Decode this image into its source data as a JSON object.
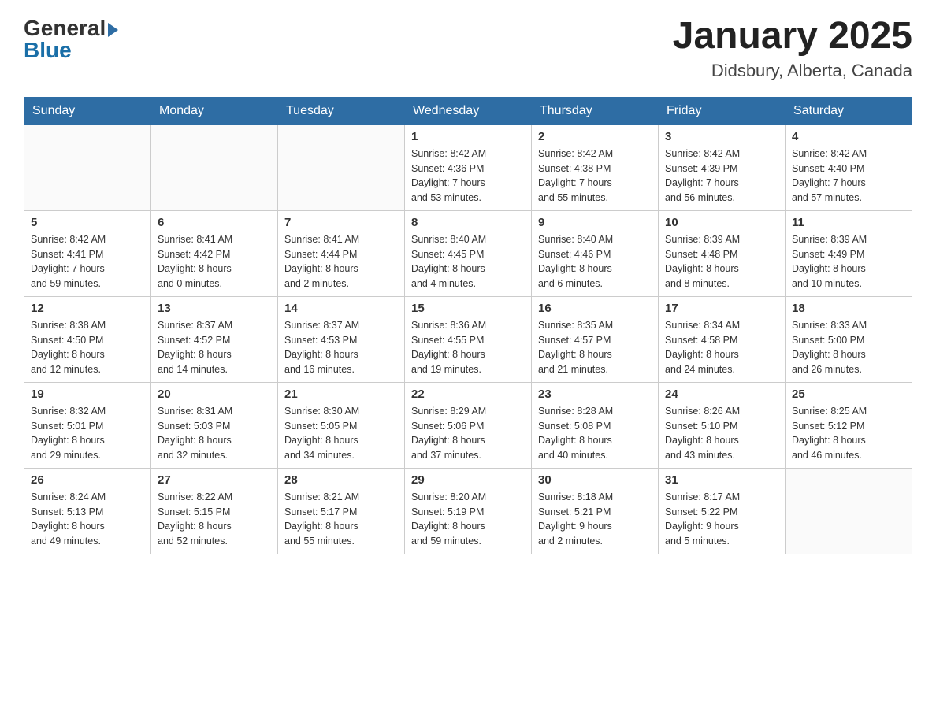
{
  "header": {
    "logo_general": "General",
    "logo_blue": "Blue",
    "month_title": "January 2025",
    "location": "Didsbury, Alberta, Canada"
  },
  "days_of_week": [
    "Sunday",
    "Monday",
    "Tuesday",
    "Wednesday",
    "Thursday",
    "Friday",
    "Saturday"
  ],
  "weeks": [
    [
      {
        "day": "",
        "info": ""
      },
      {
        "day": "",
        "info": ""
      },
      {
        "day": "",
        "info": ""
      },
      {
        "day": "1",
        "info": "Sunrise: 8:42 AM\nSunset: 4:36 PM\nDaylight: 7 hours\nand 53 minutes."
      },
      {
        "day": "2",
        "info": "Sunrise: 8:42 AM\nSunset: 4:38 PM\nDaylight: 7 hours\nand 55 minutes."
      },
      {
        "day": "3",
        "info": "Sunrise: 8:42 AM\nSunset: 4:39 PM\nDaylight: 7 hours\nand 56 minutes."
      },
      {
        "day": "4",
        "info": "Sunrise: 8:42 AM\nSunset: 4:40 PM\nDaylight: 7 hours\nand 57 minutes."
      }
    ],
    [
      {
        "day": "5",
        "info": "Sunrise: 8:42 AM\nSunset: 4:41 PM\nDaylight: 7 hours\nand 59 minutes."
      },
      {
        "day": "6",
        "info": "Sunrise: 8:41 AM\nSunset: 4:42 PM\nDaylight: 8 hours\nand 0 minutes."
      },
      {
        "day": "7",
        "info": "Sunrise: 8:41 AM\nSunset: 4:44 PM\nDaylight: 8 hours\nand 2 minutes."
      },
      {
        "day": "8",
        "info": "Sunrise: 8:40 AM\nSunset: 4:45 PM\nDaylight: 8 hours\nand 4 minutes."
      },
      {
        "day": "9",
        "info": "Sunrise: 8:40 AM\nSunset: 4:46 PM\nDaylight: 8 hours\nand 6 minutes."
      },
      {
        "day": "10",
        "info": "Sunrise: 8:39 AM\nSunset: 4:48 PM\nDaylight: 8 hours\nand 8 minutes."
      },
      {
        "day": "11",
        "info": "Sunrise: 8:39 AM\nSunset: 4:49 PM\nDaylight: 8 hours\nand 10 minutes."
      }
    ],
    [
      {
        "day": "12",
        "info": "Sunrise: 8:38 AM\nSunset: 4:50 PM\nDaylight: 8 hours\nand 12 minutes."
      },
      {
        "day": "13",
        "info": "Sunrise: 8:37 AM\nSunset: 4:52 PM\nDaylight: 8 hours\nand 14 minutes."
      },
      {
        "day": "14",
        "info": "Sunrise: 8:37 AM\nSunset: 4:53 PM\nDaylight: 8 hours\nand 16 minutes."
      },
      {
        "day": "15",
        "info": "Sunrise: 8:36 AM\nSunset: 4:55 PM\nDaylight: 8 hours\nand 19 minutes."
      },
      {
        "day": "16",
        "info": "Sunrise: 8:35 AM\nSunset: 4:57 PM\nDaylight: 8 hours\nand 21 minutes."
      },
      {
        "day": "17",
        "info": "Sunrise: 8:34 AM\nSunset: 4:58 PM\nDaylight: 8 hours\nand 24 minutes."
      },
      {
        "day": "18",
        "info": "Sunrise: 8:33 AM\nSunset: 5:00 PM\nDaylight: 8 hours\nand 26 minutes."
      }
    ],
    [
      {
        "day": "19",
        "info": "Sunrise: 8:32 AM\nSunset: 5:01 PM\nDaylight: 8 hours\nand 29 minutes."
      },
      {
        "day": "20",
        "info": "Sunrise: 8:31 AM\nSunset: 5:03 PM\nDaylight: 8 hours\nand 32 minutes."
      },
      {
        "day": "21",
        "info": "Sunrise: 8:30 AM\nSunset: 5:05 PM\nDaylight: 8 hours\nand 34 minutes."
      },
      {
        "day": "22",
        "info": "Sunrise: 8:29 AM\nSunset: 5:06 PM\nDaylight: 8 hours\nand 37 minutes."
      },
      {
        "day": "23",
        "info": "Sunrise: 8:28 AM\nSunset: 5:08 PM\nDaylight: 8 hours\nand 40 minutes."
      },
      {
        "day": "24",
        "info": "Sunrise: 8:26 AM\nSunset: 5:10 PM\nDaylight: 8 hours\nand 43 minutes."
      },
      {
        "day": "25",
        "info": "Sunrise: 8:25 AM\nSunset: 5:12 PM\nDaylight: 8 hours\nand 46 minutes."
      }
    ],
    [
      {
        "day": "26",
        "info": "Sunrise: 8:24 AM\nSunset: 5:13 PM\nDaylight: 8 hours\nand 49 minutes."
      },
      {
        "day": "27",
        "info": "Sunrise: 8:22 AM\nSunset: 5:15 PM\nDaylight: 8 hours\nand 52 minutes."
      },
      {
        "day": "28",
        "info": "Sunrise: 8:21 AM\nSunset: 5:17 PM\nDaylight: 8 hours\nand 55 minutes."
      },
      {
        "day": "29",
        "info": "Sunrise: 8:20 AM\nSunset: 5:19 PM\nDaylight: 8 hours\nand 59 minutes."
      },
      {
        "day": "30",
        "info": "Sunrise: 8:18 AM\nSunset: 5:21 PM\nDaylight: 9 hours\nand 2 minutes."
      },
      {
        "day": "31",
        "info": "Sunrise: 8:17 AM\nSunset: 5:22 PM\nDaylight: 9 hours\nand 5 minutes."
      },
      {
        "day": "",
        "info": ""
      }
    ]
  ]
}
